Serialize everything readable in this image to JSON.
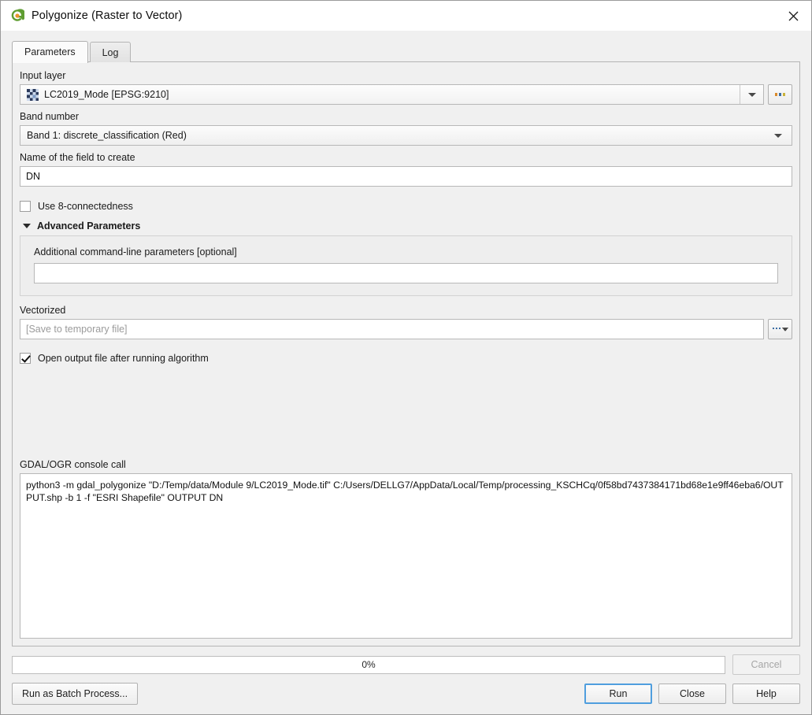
{
  "window": {
    "title": "Polygonize (Raster to Vector)",
    "app_icon": "qgis-logo-icon",
    "close_icon": "close-icon"
  },
  "tabs": [
    {
      "label": "Parameters",
      "active": true
    },
    {
      "label": "Log",
      "active": false
    }
  ],
  "parameters": {
    "input_layer": {
      "label": "Input layer",
      "value": "LC2019_Mode [EPSG:9210]",
      "icon": "raster-layer-icon",
      "browse_label": "..."
    },
    "band_number": {
      "label": "Band number",
      "value": "Band 1: discrete_classification (Red)"
    },
    "field_name": {
      "label": "Name of the field to create",
      "value": "DN"
    },
    "connectedness": {
      "label": "Use 8-connectedness",
      "checked": false
    },
    "advanced": {
      "label": "Advanced Parameters",
      "expanded": true,
      "additional_params": {
        "label": "Additional command-line parameters [optional]",
        "value": ""
      }
    },
    "output": {
      "label": "Vectorized",
      "placeholder": "[Save to temporary file]",
      "value": "",
      "browse_label": "..."
    },
    "open_output": {
      "label": "Open output file after running algorithm",
      "checked": true
    }
  },
  "console": {
    "label": "GDAL/OGR console call",
    "text": "python3 -m gdal_polygonize \"D:/Temp/data/Module 9/LC2019_Mode.tif\" C:/Users/DELLG7/AppData/Local/Temp/processing_KSCHCq/0f58bd7437384171bd68e1e9ff46eba6/OUTPUT.shp -b 1 -f \"ESRI Shapefile\" OUTPUT DN"
  },
  "footer": {
    "progress_text": "0%",
    "progress_percent": 0,
    "cancel_label": "Cancel",
    "cancel_disabled": true,
    "batch_label": "Run as Batch Process...",
    "run_label": "Run",
    "close_label": "Close",
    "help_label": "Help"
  },
  "colors": {
    "accent": "#4f9ede",
    "dialog_bg": "#f0f0f0",
    "field_bg": "#ffffff"
  }
}
